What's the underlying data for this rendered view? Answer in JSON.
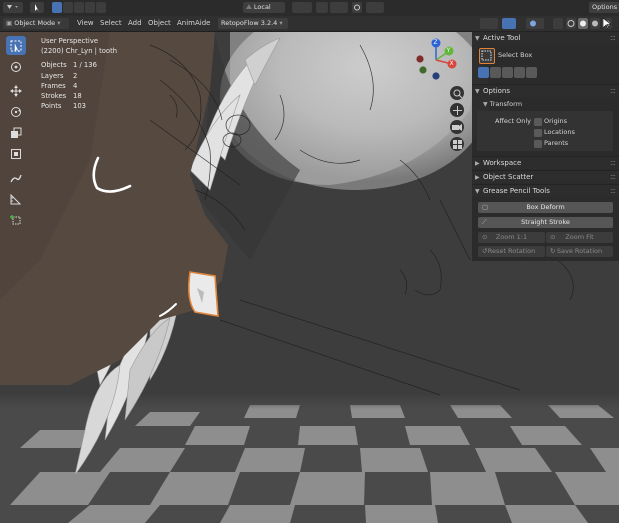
{
  "topbar": {
    "mode": "Object Mode",
    "menus": [
      "View",
      "Select",
      "Add",
      "Object",
      "AnimAide"
    ],
    "addon": "RetopoFlow 3.2.4",
    "transform_orientation": "Local",
    "options_label": "Options"
  },
  "overlay": {
    "view_name": "User Perspective",
    "object_line": "(2200) Chr_Lyn | tooth",
    "stats": [
      {
        "label": "Objects",
        "value": "1 / 136"
      },
      {
        "label": "Layers",
        "value": "2"
      },
      {
        "label": "Frames",
        "value": "4"
      },
      {
        "label": "Strokes",
        "value": "18"
      },
      {
        "label": "Points",
        "value": "103"
      }
    ]
  },
  "toolbar_icons": [
    "select-box-icon",
    "cursor-icon",
    "move-icon",
    "rotate-icon",
    "scale-icon",
    "transform-icon",
    "annotate-icon",
    "measure-icon",
    "add-cube-icon"
  ],
  "gizmo": {
    "z": "Z",
    "y": "Y",
    "x": "X"
  },
  "npanel": {
    "active_tool": {
      "title": "Active Tool",
      "tool_name": "Select Box"
    },
    "options": {
      "title": "Options",
      "transform_title": "Transform",
      "affect_only": "Affect Only",
      "checkboxes": [
        "Origins",
        "Locations",
        "Parents"
      ]
    },
    "workspace": "Workspace",
    "object_scatter": "Object Scatter",
    "gp_tools": {
      "title": "Grease Pencil Tools",
      "box_deform": "Box Deform",
      "straight_stroke": "Straight Stroke",
      "zoom_11": "Zoom 1:1",
      "zoom_fit": "Zoom Fit",
      "reset_rotation": "Reset Rotation",
      "save_rotation": "Save Rotation"
    }
  },
  "colors": {
    "accent": "#4772b3",
    "header": "#303030",
    "panel": "#2a2a2a",
    "stroke_white": "#ffffff",
    "stroke_orange": "#e0843a"
  }
}
